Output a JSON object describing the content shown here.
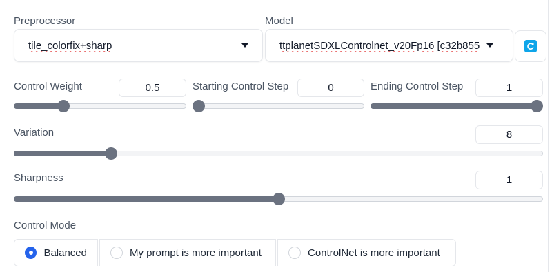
{
  "preprocessor": {
    "label": "Preprocessor",
    "value": "tile_colorfix+sharp"
  },
  "model": {
    "label": "Model",
    "value": "ttplanetSDXLControlnet_v20Fp16 [c32b855"
  },
  "control_weight": {
    "label": "Control Weight",
    "value": "0.5",
    "fraction": 0.27
  },
  "starting_step": {
    "label": "Starting Control Step",
    "value": "0",
    "fraction": 0.0
  },
  "ending_step": {
    "label": "Ending Control Step",
    "value": "1",
    "fraction": 1.0
  },
  "variation": {
    "label": "Variation",
    "value": "8",
    "fraction": 0.176
  },
  "sharpness": {
    "label": "Sharpness",
    "value": "1",
    "fraction": 0.5
  },
  "control_mode": {
    "label": "Control Mode",
    "options": [
      "Balanced",
      "My prompt is more important",
      "ControlNet is more important"
    ],
    "selected": "Balanced"
  },
  "colors": {
    "accent": "#2563eb",
    "refresh_icon": "#0ea5e9",
    "slider": "#6b7280"
  },
  "icons": {
    "refresh": "refresh-icon",
    "dropdown": "chevron-down-icon"
  }
}
